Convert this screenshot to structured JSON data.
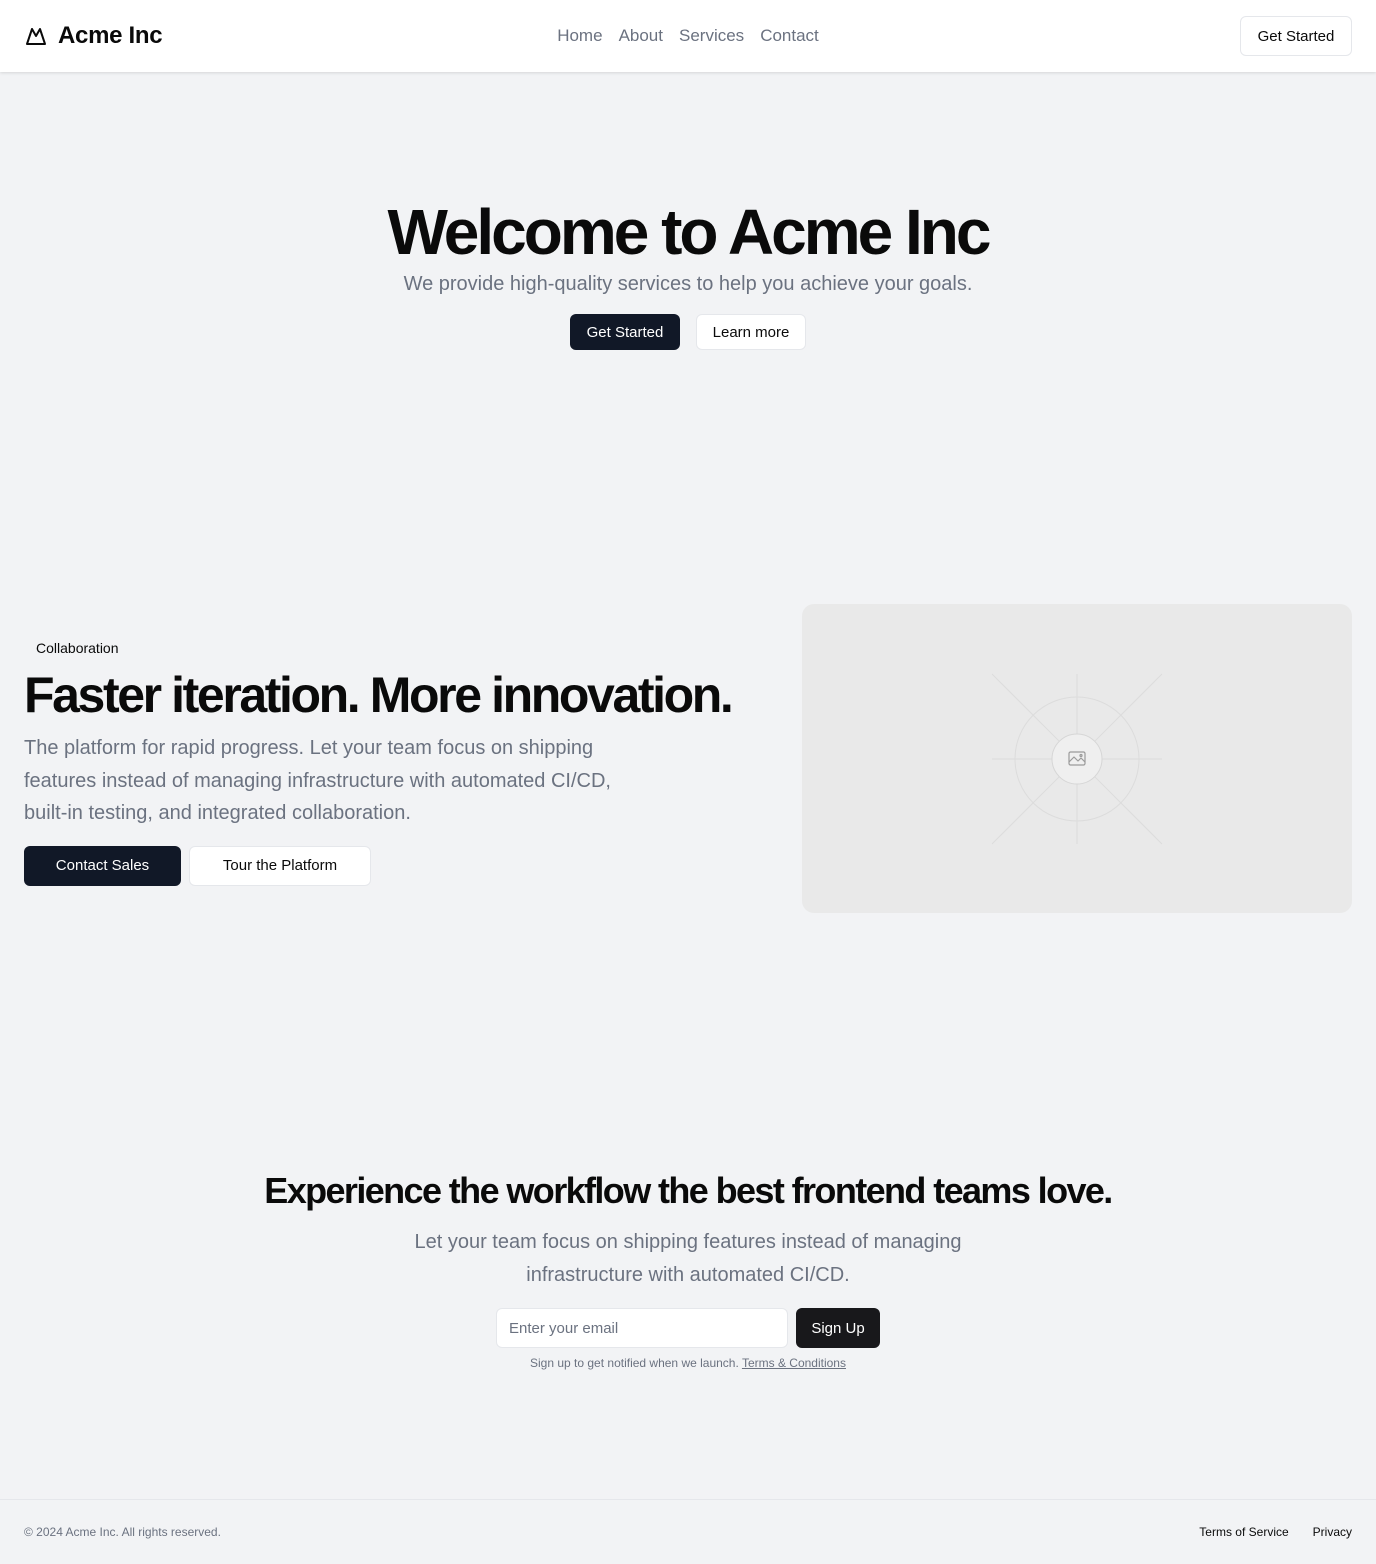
{
  "header": {
    "brand": "Acme Inc",
    "brand_icon": "mountain-icon",
    "nav": [
      "Home",
      "About",
      "Services",
      "Contact"
    ],
    "cta": "Get Started"
  },
  "hero": {
    "title": "Welcome to Acme Inc",
    "subtitle": "We provide high-quality services to help you achieve your goals.",
    "primary_button": "Get Started",
    "secondary_button": "Learn more"
  },
  "feature": {
    "badge": "Collaboration",
    "title": "Faster iteration. More innovation.",
    "body": "The platform for rapid progress. Let your team focus on shipping features instead of managing infrastructure with automated CI/CD, built-in testing, and integrated collaboration.",
    "primary_button": "Contact Sales",
    "secondary_button": "Tour the Platform",
    "image_icon": "image-placeholder-icon"
  },
  "signup": {
    "title": "Experience the workflow the best frontend teams love.",
    "subtitle": "Let your team focus on shipping features instead of managing infrastructure with automated CI/CD.",
    "email_placeholder": "Enter your email",
    "button": "Sign Up",
    "note": "Sign up to get notified when we launch.",
    "terms_link": "Terms & Conditions"
  },
  "footer": {
    "copyright": "© 2024 Acme Inc. All rights reserved.",
    "links": [
      "Terms of Service",
      "Privacy"
    ]
  },
  "colors": {
    "background": "#f2f3f5",
    "primary_button": "#111827",
    "muted_text": "#6b7280",
    "placeholder_bg": "#e9e9e9"
  }
}
